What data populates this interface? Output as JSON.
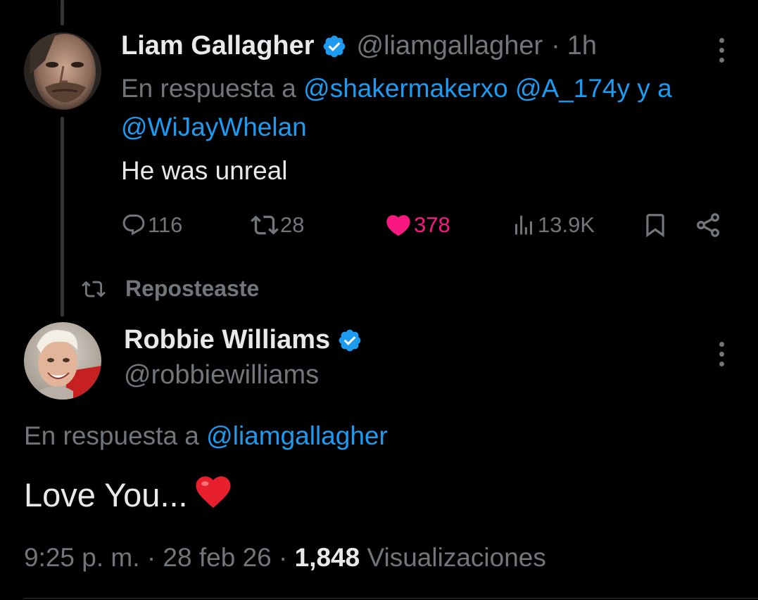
{
  "tweet1": {
    "author_name": "Liam Gallagher",
    "handle": "@liamgallagher",
    "separator": "·",
    "time": "1h",
    "reply_prefix": "En respuesta a",
    "mentions": [
      "@shakermakerxo",
      "@A_174y",
      "@WiJayWhelan"
    ],
    "mention_joiner": "y a",
    "text": "He was unreal",
    "stats": {
      "replies": "116",
      "reposts": "28",
      "likes": "378",
      "views": "13.9K"
    },
    "liked": true
  },
  "repost_banner": {
    "label": "Reposteaste",
    "icon": "repost-icon"
  },
  "tweet2": {
    "author_name": "Robbie Williams",
    "handle": "@robbiewilliams",
    "reply_prefix": "En respuesta a",
    "reply_mention": "@liamgallagher",
    "text": "Love You...",
    "emoji": "red-heart-emoji",
    "meta": {
      "time": "9:25 p. m.",
      "sep1": "·",
      "date": "28 feb 26",
      "sep2": "·",
      "views_count": "1,848",
      "views_label": "Visualizaciones"
    }
  },
  "colors": {
    "background": "#000000",
    "text_primary": "#e7e9ea",
    "text_secondary": "#71767b",
    "link": "#1d9bf0",
    "like": "#f91880",
    "verified": "#1d9bf0"
  }
}
